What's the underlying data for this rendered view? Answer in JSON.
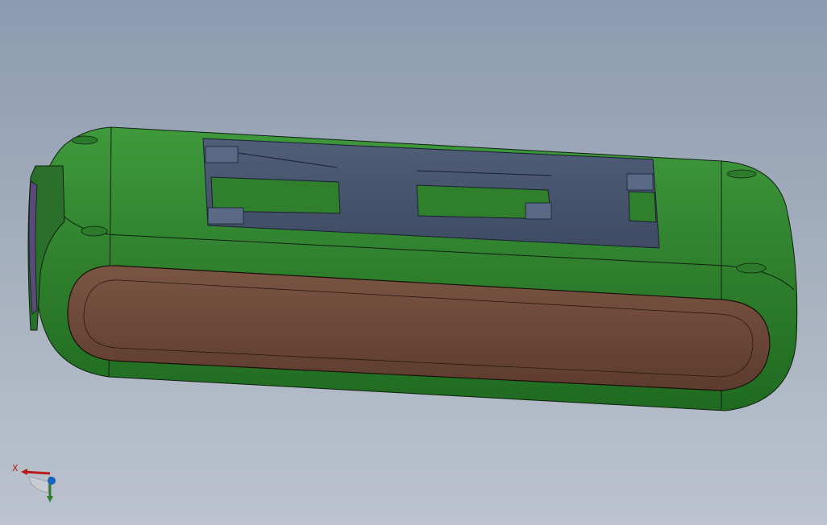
{
  "viewport": {
    "background_top": "#8c9bb0",
    "background_bottom": "#bcc3ce"
  },
  "model": {
    "body_color": "#2e7d32",
    "body_highlight": "#4caf50",
    "slot_color": "#485670",
    "pad_color": "#6d4c3d",
    "edge_color": "#0d1a0d"
  },
  "triad": {
    "x_label": "X",
    "x_color": "#b71c1c",
    "y_color": "#2e7d32",
    "z_color": "#1565c0"
  }
}
